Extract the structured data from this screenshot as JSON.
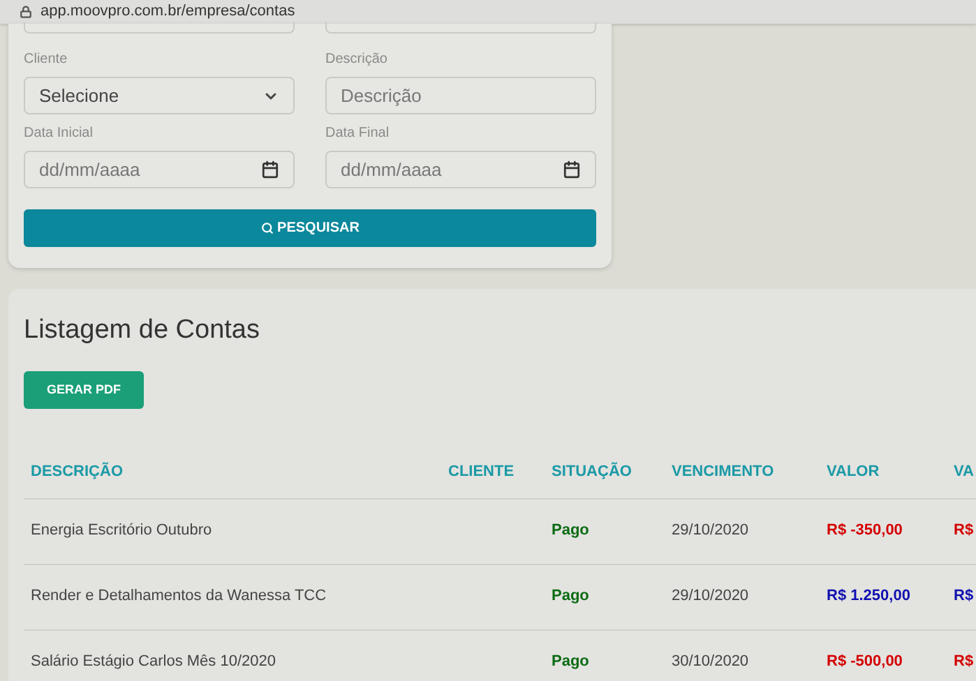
{
  "address_bar": {
    "url": "app.moovpro.com.br/empresa/contas"
  },
  "filters": {
    "fields": [
      {
        "kind": "select",
        "label": "Cliente",
        "value": "Selecione"
      },
      {
        "kind": "text",
        "label": "Descrição",
        "placeholder": "Descrição"
      },
      {
        "kind": "date",
        "label": "Data Inicial",
        "placeholder": "dd/mm/aaaa"
      },
      {
        "kind": "date",
        "label": "Data Final",
        "placeholder": "dd/mm/aaaa"
      }
    ],
    "search_button": "PESQUISAR"
  },
  "listing": {
    "title": "Listagem de Contas",
    "pdf_button": "GERAR PDF",
    "table": {
      "columns": [
        "DESCRIÇÃO",
        "CLIENTE",
        "SITUAÇÃO",
        "VENCIMENTO",
        "VALOR",
        "VA"
      ],
      "rows": [
        {
          "description": "Energia Escritório Outubro",
          "status": "Pago",
          "due": "29/10/2020",
          "value": "R$ -350,00",
          "column_6": "R$",
          "color": "#d40000"
        },
        {
          "description": "Render e Detalhamentos da Wanessa TCC",
          "status": "Pago",
          "due": "29/10/2020",
          "value": "R$ 1.250,00",
          "column_6": "R$",
          "color": "#1010b0"
        },
        {
          "description": "Salário Estágio Carlos Mês 10/2020",
          "status": "Pago",
          "due": "30/10/2020",
          "value": "R$ -500,00",
          "column_6": "R$",
          "color": "#d40000"
        }
      ]
    }
  }
}
